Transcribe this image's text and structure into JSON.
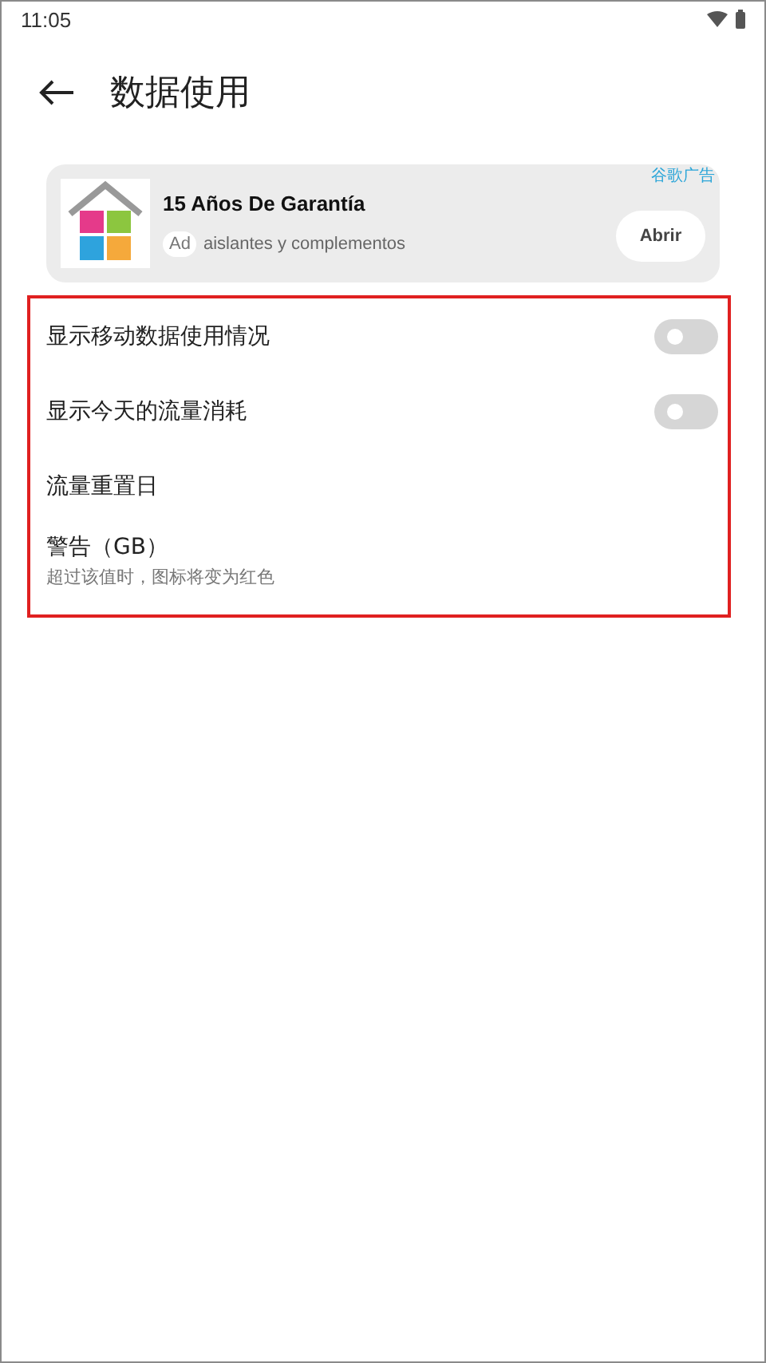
{
  "status_bar": {
    "time": "11:05"
  },
  "app_bar": {
    "title": "数据使用"
  },
  "ad": {
    "title": "15 Años De Garantía",
    "badge": "Ad",
    "description": "aislantes y complementos",
    "attribution": "谷歌广告",
    "button": "Abrir"
  },
  "settings": {
    "highlighted": true,
    "items": [
      {
        "kind": "switch",
        "label": "显示移动数据使用情况",
        "on": false
      },
      {
        "kind": "switch",
        "label": "显示今天的流量消耗",
        "on": false
      },
      {
        "kind": "plain",
        "label": "流量重置日"
      },
      {
        "kind": "plain",
        "label": "警告（GB）",
        "subtitle": "超过该值时，图标将变为红色"
      }
    ]
  }
}
